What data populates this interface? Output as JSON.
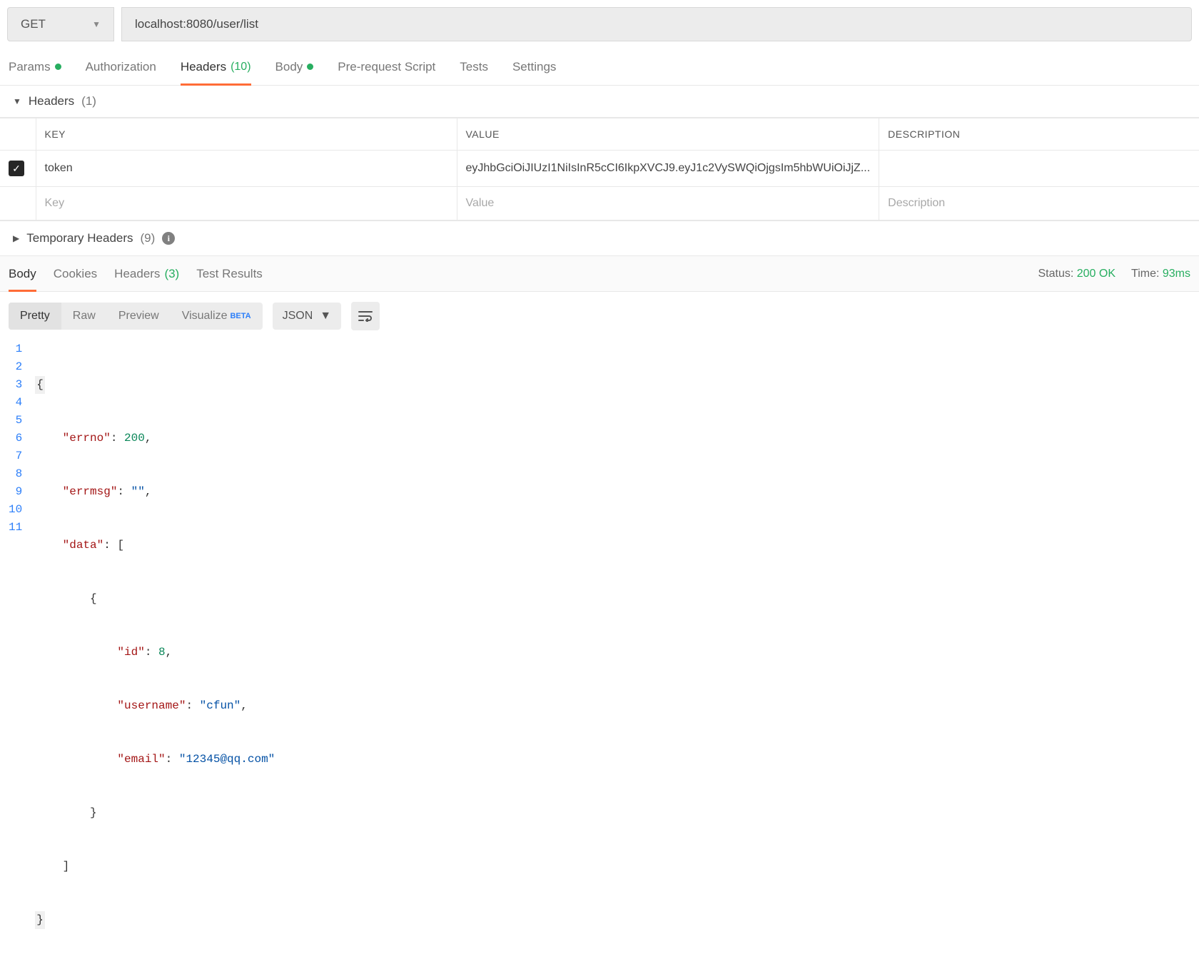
{
  "request": {
    "method": "GET",
    "url": "localhost:8080/user/list"
  },
  "tabs": {
    "params": "Params",
    "authorization": "Authorization",
    "headers": "Headers",
    "headers_count": "(10)",
    "body": "Body",
    "prerequest": "Pre-request Script",
    "tests": "Tests",
    "settings": "Settings"
  },
  "headers_section": {
    "title": "Headers",
    "count": "(1)",
    "columns": {
      "key": "KEY",
      "value": "VALUE",
      "desc": "DESCRIPTION"
    },
    "rows": [
      {
        "checked": true,
        "key": "token",
        "value": "eyJhbGciOiJIUzI1NiIsInR5cCI6IkpXVCJ9.eyJ1c2VySWQiOjgsIm5hbWUiOiJjZ...",
        "desc": ""
      }
    ],
    "placeholders": {
      "key": "Key",
      "value": "Value",
      "desc": "Description"
    }
  },
  "temp_headers": {
    "title": "Temporary Headers",
    "count": "(9)"
  },
  "response_tabs": {
    "body": "Body",
    "cookies": "Cookies",
    "headers": "Headers",
    "headers_count": "(3)",
    "tests": "Test Results"
  },
  "status": {
    "status_label": "Status:",
    "status_value": "200 OK",
    "time_label": "Time:",
    "time_value": "93ms"
  },
  "viewmode": {
    "pretty": "Pretty",
    "raw": "Raw",
    "preview": "Preview",
    "visualize": "Visualize",
    "beta": "BETA",
    "format": "JSON"
  },
  "json": {
    "errno_key": "\"errno\"",
    "errno_val": "200",
    "errmsg_key": "\"errmsg\"",
    "errmsg_val": "\"\"",
    "data_key": "\"data\"",
    "id_key": "\"id\"",
    "id_val": "8",
    "username_key": "\"username\"",
    "username_val": "\"cfun\"",
    "email_key": "\"email\"",
    "email_val": "\"12345@qq.com\""
  },
  "linenums": [
    "1",
    "2",
    "3",
    "4",
    "5",
    "6",
    "7",
    "8",
    "9",
    "10",
    "11"
  ]
}
